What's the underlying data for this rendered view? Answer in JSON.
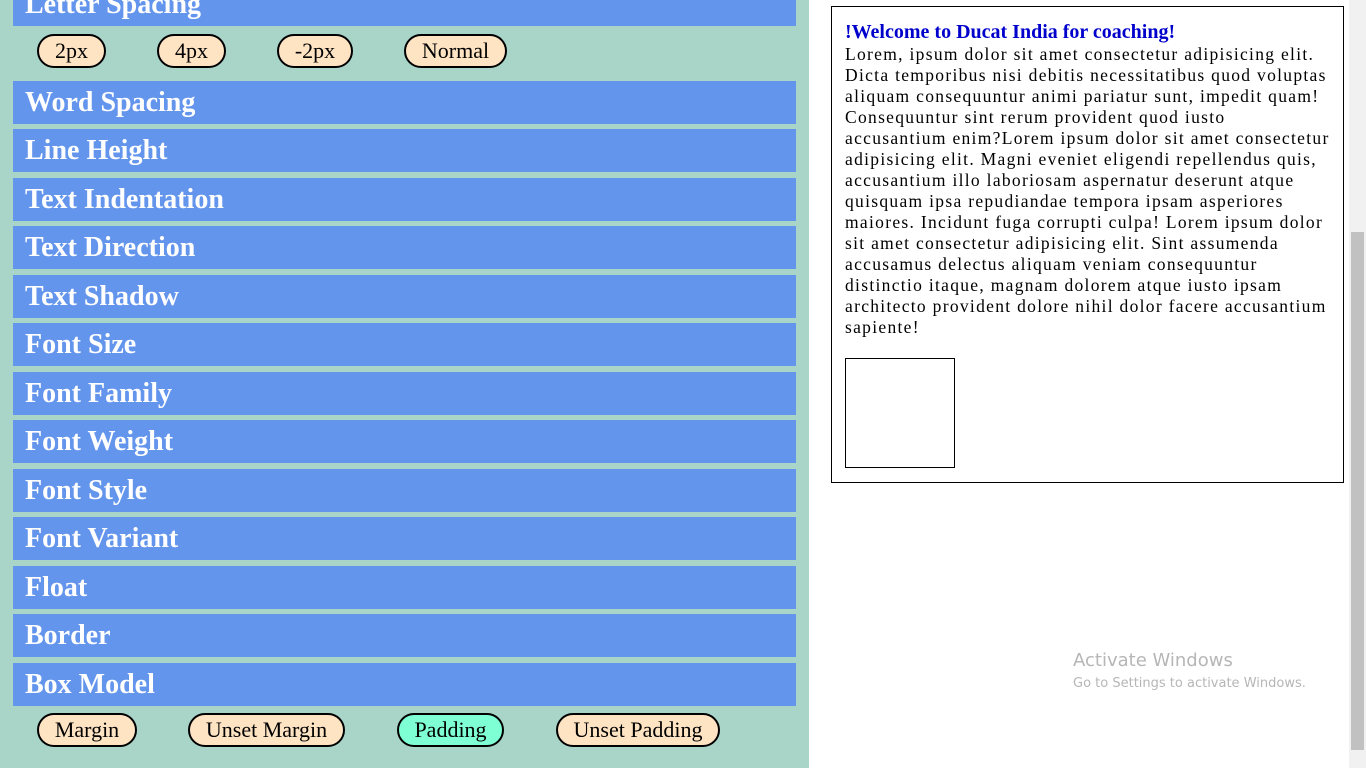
{
  "controls": {
    "letter_spacing": {
      "title": "Letter Spacing",
      "buttons": [
        "2px",
        "4px",
        "-2px",
        "Normal"
      ]
    },
    "sections": [
      "Word Spacing",
      "Line Height",
      "Text Indentation",
      "Text Direction",
      "Text Shadow",
      "Font Size",
      "Font Family",
      "Font Weight",
      "Font Style",
      "Font Variant",
      "Float",
      "Border",
      "Box Model"
    ],
    "box_model_buttons": [
      "Margin",
      "Unset Margin",
      "Padding",
      "Unset Padding"
    ],
    "active_button": "Padding"
  },
  "preview": {
    "heading": "!Welcome to Ducat India for coaching!",
    "body": "Lorem, ipsum dolor sit amet consectetur adipisicing elit. Dicta temporibus nisi debitis necessitatibus quod voluptas aliquam consequuntur animi pariatur sunt, impedit quam! Consequuntur sint rerum provident quod iusto accusantium enim?Lorem ipsum dolor sit amet consectetur adipisicing elit. Magni eveniet eligendi repellendus quis, accusantium illo laboriosam aspernatur deserunt atque quisquam ipsa repudiandae tempora ipsam asperiores maiores. Incidunt fuga corrupti culpa! Lorem ipsum dolor sit amet consectetur adipisicing elit. Sint assumenda accusamus delectus aliquam veniam consequuntur distinctio itaque, magnam dolorem atque iusto ipsam architecto provident dolore nihil dolor facere accusantium sapiente!"
  },
  "watermark": {
    "title": "Activate Windows",
    "subtitle": "Go to Settings to activate Windows."
  },
  "colors": {
    "panel_bg": "#a8d5c7",
    "section_bar": "#6495ed",
    "pill_bg": "#ffe4c4",
    "pill_active": "#7fffd4",
    "heading_text": "#0000cd"
  }
}
